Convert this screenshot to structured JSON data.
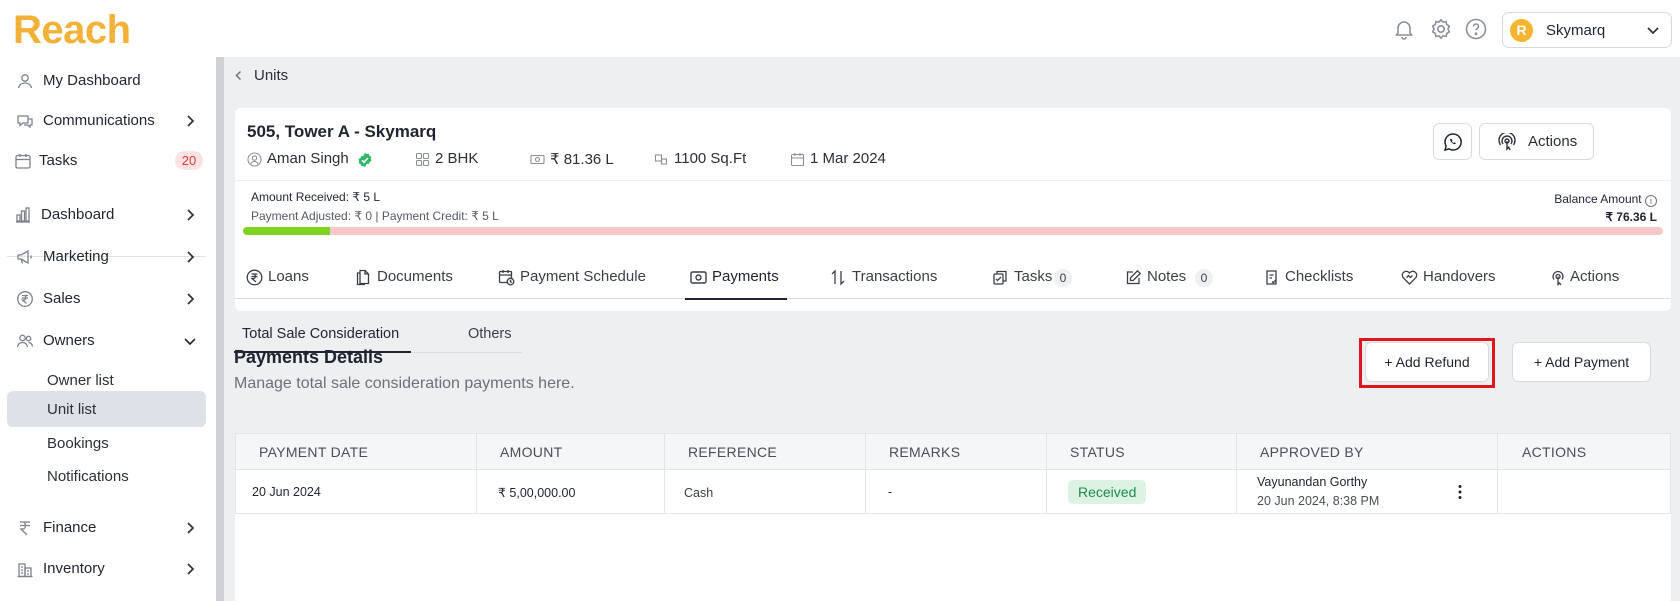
{
  "app": {
    "logo_text": "Reach",
    "brand_color": "#f2b23a"
  },
  "topbar": {
    "icons": [
      "bell-icon",
      "settings-icon",
      "help-icon"
    ],
    "profile": {
      "avatar_letter": "R",
      "name": "Skymarq"
    }
  },
  "sidebar": {
    "my_dashboard": "My Dashboard",
    "communications": "Communications",
    "tasks": "Tasks",
    "tasks_count": "20",
    "dashboard": "Dashboard",
    "marketing": "Marketing",
    "sales": "Sales",
    "owners": "Owners",
    "owner_list": "Owner list",
    "unit_list": "Unit list",
    "bookings": "Bookings",
    "notifications": "Notifications",
    "finance": "Finance",
    "inventory": "Inventory"
  },
  "breadcrumb": {
    "label": "Units"
  },
  "unit": {
    "title": "505, Tower A - Skymarq",
    "owner": "Aman Singh",
    "type": "2 BHK",
    "price": "₹ 81.36 L",
    "area": "1100 Sq.Ft",
    "date": "1 Mar 2024",
    "actions_label": "Actions",
    "amount_received": "Amount Received: ₹ 5 L",
    "payment_adjusted": "Payment Adjusted: ₹ 0 | Payment Credit: ₹ 5 L",
    "balance_label": "Balance Amount",
    "balance_value": "₹ 76.36 L",
    "paid_fraction": 0.0615,
    "progress_colors": {
      "paid": "#7ed321",
      "remaining": "#f8c7c7"
    }
  },
  "tabs": {
    "loans": "Loans",
    "documents": "Documents",
    "payment_schedule": "Payment Schedule",
    "payments": "Payments",
    "transactions": "Transactions",
    "tasks": "Tasks",
    "tasks_count": "0",
    "notes": "Notes",
    "notes_count": "0",
    "checklists": "Checklists",
    "handovers": "Handovers",
    "actions": "Actions"
  },
  "subtabs": {
    "total_sale": "Total Sale Consideration",
    "others": "Others"
  },
  "payments": {
    "title": "Payments Details",
    "subtitle": "Manage total sale consideration payments here.",
    "add_refund": "+ Add Refund",
    "add_payment": "+ Add Payment",
    "columns": [
      "PAYMENT DATE",
      "AMOUNT",
      "REFERENCE",
      "REMARKS",
      "STATUS",
      "APPROVED BY",
      "ACTIONS"
    ],
    "rows": [
      {
        "date": "20 Jun 2024",
        "amount": "₹ 5,00,000.00",
        "reference": "Cash",
        "remarks": "-",
        "status": "Received",
        "approved_by": "Vayunandan Gorthy",
        "approved_at": "20 Jun 2024, 8:38 PM"
      }
    ],
    "status_color": "#1f8a4b",
    "highlight_color": "#e0161e"
  }
}
